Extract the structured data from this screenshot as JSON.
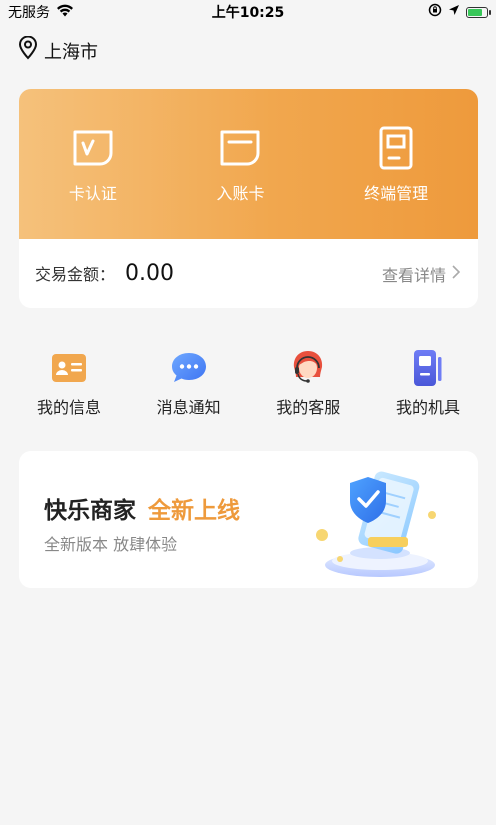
{
  "status_bar": {
    "carrier": "无服务",
    "time": "上午10:25"
  },
  "location": {
    "city": "上海市"
  },
  "card_actions": [
    {
      "label": "卡认证",
      "icon": "card-verify-icon"
    },
    {
      "label": "入账卡",
      "icon": "bank-card-icon"
    },
    {
      "label": "终端管理",
      "icon": "terminal-icon"
    }
  ],
  "amount": {
    "label": "交易金额：",
    "value": "0.00",
    "detail_link": "查看详情"
  },
  "quick_menu": [
    {
      "label": "我的信息",
      "icon": "id-card-icon"
    },
    {
      "label": "消息通知",
      "icon": "message-icon"
    },
    {
      "label": "我的客服",
      "icon": "customer-service-icon"
    },
    {
      "label": "我的机具",
      "icon": "pos-device-icon"
    }
  ],
  "promo": {
    "title": "快乐商家",
    "highlight": "全新上线",
    "subtitle": "全新版本 放肆体验"
  },
  "colors": {
    "accent": "#ee9a3c",
    "card_gradient_start": "#f5c17b",
    "card_gradient_end": "#ee9a3c",
    "background": "#f5f5f5"
  }
}
